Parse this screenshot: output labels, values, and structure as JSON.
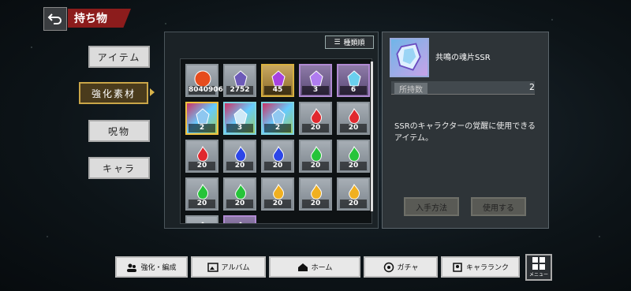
{
  "header": {
    "title": "持ち物"
  },
  "tabs": [
    {
      "label": "アイテム",
      "active": false
    },
    {
      "label": "強化素材",
      "active": true
    },
    {
      "label": "呪物",
      "active": false
    },
    {
      "label": "キャラ",
      "active": false
    }
  ],
  "sort": {
    "label": "種類順"
  },
  "items": [
    {
      "count": "8040906",
      "style": "plain",
      "color": "#e64c1d",
      "icon": "gold-coin-icon"
    },
    {
      "count": "2752",
      "style": "plain",
      "color": "#6c5ab8",
      "icon": "purple-crystal-icon"
    },
    {
      "count": "45",
      "style": "gold",
      "color": "#a742e0",
      "icon": "star-crystal-icon"
    },
    {
      "count": "3",
      "style": "purple",
      "color": "#b07cf0",
      "icon": "star-crystal-icon"
    },
    {
      "count": "6",
      "style": "purple",
      "color": "#6ad0ee",
      "icon": "crystal-shard-icon"
    },
    {
      "count": "2",
      "style": "rainbow",
      "color": "#8ec7f0",
      "icon": "soul-fragment-icon",
      "selected": true
    },
    {
      "count": "3",
      "style": "rainbow",
      "color": "#cfe9f7",
      "icon": "feather-icon"
    },
    {
      "count": "2",
      "style": "rainbow",
      "color": "#90c8f0",
      "icon": "hand-crystal-icon"
    },
    {
      "count": "20",
      "style": "plain",
      "color": "#e0282e",
      "icon": "red-flame-icon"
    },
    {
      "count": "20",
      "style": "plain",
      "color": "#e0282e",
      "icon": "red-flame-icon"
    },
    {
      "count": "20",
      "style": "plain",
      "color": "#e0282e",
      "icon": "red-flame-icon"
    },
    {
      "count": "20",
      "style": "plain",
      "color": "#2c46e8",
      "icon": "blue-flame-icon"
    },
    {
      "count": "20",
      "style": "plain",
      "color": "#2c46e8",
      "icon": "blue-flame-icon"
    },
    {
      "count": "20",
      "style": "plain",
      "color": "#26c43a",
      "icon": "green-flame-icon"
    },
    {
      "count": "20",
      "style": "plain",
      "color": "#26c43a",
      "icon": "green-flame-icon"
    },
    {
      "count": "20",
      "style": "plain",
      "color": "#26c43a",
      "icon": "green-flame-icon"
    },
    {
      "count": "20",
      "style": "plain",
      "color": "#26c43a",
      "icon": "green-flame-icon"
    },
    {
      "count": "20",
      "style": "plain",
      "color": "#f0b020",
      "icon": "yellow-flame-icon"
    },
    {
      "count": "20",
      "style": "plain",
      "color": "#f0b020",
      "icon": "yellow-flame-icon"
    },
    {
      "count": "20",
      "style": "plain",
      "color": "#f0b020",
      "icon": "yellow-flame-icon"
    },
    {
      "count": "",
      "style": "plain",
      "color": "#6060d0",
      "icon": "item-icon"
    },
    {
      "count": "",
      "style": "purple",
      "color": "#a070d0",
      "icon": "item-icon"
    }
  ],
  "detail": {
    "name": "共鳴の魂片SSR",
    "own_label": "所持数",
    "own_value": "2",
    "description_1": "SSRのキャラクターの覚醒に使用できる",
    "description_2": "アイテム。",
    "btn_obtain": "入手方法",
    "btn_use": "使用する"
  },
  "nav": {
    "enhance": "強化・編成",
    "album": "アルバム",
    "home": "ホーム",
    "gacha": "ガチャ",
    "ranking": "キャラランク",
    "menu": "メニュー"
  }
}
